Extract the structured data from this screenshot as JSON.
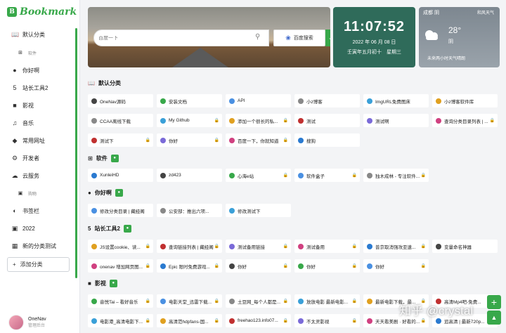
{
  "app": {
    "logo_text": "Bookmark"
  },
  "sidebar": {
    "items": [
      {
        "label": "默认分类",
        "icon": "book-icon"
      },
      {
        "label": "软件",
        "icon": "windows-icon",
        "sub": true
      },
      {
        "label": "你好啊",
        "icon": "linux-icon"
      },
      {
        "label": "站长工具2",
        "icon": "html5-icon"
      },
      {
        "label": "影视",
        "icon": "video-icon"
      },
      {
        "label": "音乐",
        "icon": "music-icon"
      },
      {
        "label": "常用网址",
        "icon": "cube-icon"
      },
      {
        "label": "开发者",
        "icon": "gear-icon"
      },
      {
        "label": "云服务",
        "icon": "cloud-icon"
      },
      {
        "label": "购物",
        "icon": "cart-icon",
        "sub": true
      },
      {
        "label": "书签栏",
        "icon": "halfcircle-icon"
      },
      {
        "label": "2022",
        "icon": "portrait-icon"
      },
      {
        "label": "新的分类测试",
        "icon": "calendar-icon"
      }
    ],
    "add_label": "添加分类",
    "user": {
      "name": "OneNav",
      "sub": "管理后台"
    }
  },
  "search": {
    "placeholder": "百度一下",
    "engine": "百度搜索"
  },
  "clock": {
    "time": "11:07:52",
    "date": "2022 年 06 月 08 日",
    "lunar": "壬寅年五月初十　星期三"
  },
  "weather": {
    "city": "成都 阴",
    "source": "和风天气",
    "temp": "28°",
    "cond": "阴",
    "forecast": "未来两小时天气晴朗"
  },
  "sections": [
    {
      "title": "默认分类",
      "icon": "book-icon",
      "lock": false
    },
    {
      "title": "软件",
      "icon": "windows-icon",
      "lock": true
    },
    {
      "title": "你好啊",
      "icon": "linux-icon",
      "lock": true
    },
    {
      "title": "站长工具2",
      "icon": "html5-icon",
      "lock": true
    },
    {
      "title": "影视",
      "icon": "video-icon",
      "lock": true
    }
  ],
  "cards": [
    [
      "OneNav源码",
      "安装文档",
      "API",
      "小z博客",
      "ImgURL免费图床",
      "小z博客软件库"
    ],
    [
      "CCAA离线下载",
      "My Github",
      "添加一个很长的私...",
      "测试",
      "测试啊",
      "查询分类目录列表 | ..."
    ],
    [
      "测试下",
      "你好",
      "百度一下，你就知道",
      "搜狗"
    ],
    [
      "XunleiHD",
      "zd423",
      "心海e站",
      "软件盒子",
      "独木成林 - 专注软件..."
    ],
    [
      "修改分类目录 | 藏经阁",
      "公安部：推出六项...",
      "修改测试下"
    ],
    [
      "JS设置cookie、读...",
      "查询链接列表 | 藏经阁",
      "测试备用链接",
      "测试备用",
      "普京取消强攻亚速...",
      "变量命名神器"
    ],
    [
      "onenav 增加网页图...",
      "Epic 限时免费游戏...",
      "你好",
      "你好",
      "你好"
    ],
    [
      "音悦Tai – 看好音乐",
      "电影天堂_迅雷下载...",
      "土豆网_每个人都是...",
      "放放电影 最新电影...",
      "最新电影下载，最...",
      "高清Mp4吧-免费..."
    ],
    [
      "电影港_高清电影下...",
      "高清范hdpfans-国...",
      "freehao123.info07...",
      "不太灵影视",
      "天天看美剧 · 好看的...",
      "追高清 | 最新720p..."
    ]
  ],
  "watermark": "知乎 @crystal",
  "colors": {
    "accent": "#38a84a",
    "clock_bg": "#2f6b5a"
  }
}
